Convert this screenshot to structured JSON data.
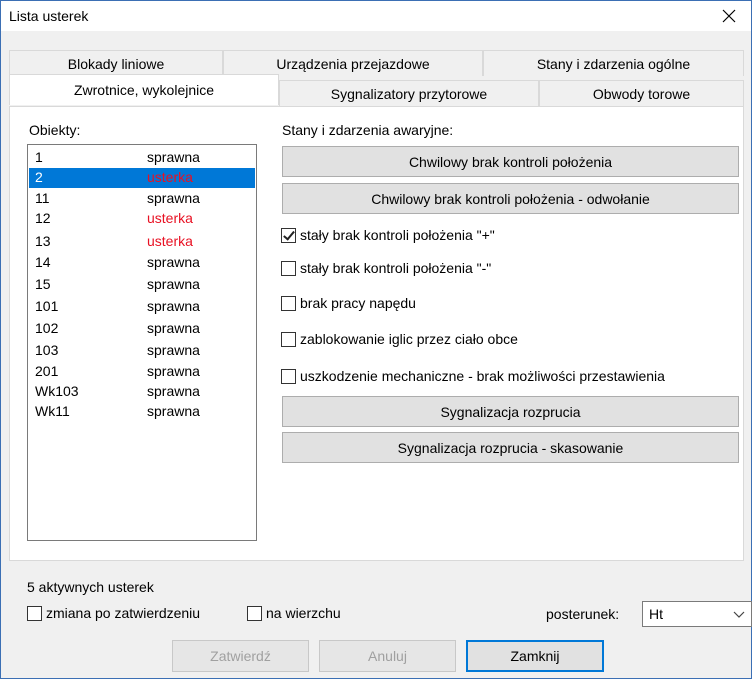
{
  "window": {
    "title": "Lista usterek"
  },
  "tabs": {
    "top": [
      {
        "label": "Blokady liniowe"
      },
      {
        "label": "Urządzenia przejazdowe"
      },
      {
        "label": "Stany i zdarzenia ogólne"
      }
    ],
    "bottom": [
      {
        "label": "Zwrotnice, wykolejnice",
        "active": true
      },
      {
        "label": "Sygnalizatory przytorowe"
      },
      {
        "label": "Obwody torowe"
      }
    ]
  },
  "objects": {
    "label": "Obiekty:",
    "items": [
      {
        "name": "1",
        "state": "sprawna"
      },
      {
        "name": "2",
        "state": "usterka",
        "selected": true
      },
      {
        "name": "11",
        "state": "sprawna"
      },
      {
        "name": "12",
        "state": "usterka"
      },
      {
        "name": "13",
        "state": "usterka"
      },
      {
        "name": "14",
        "state": "sprawna"
      },
      {
        "name": "15",
        "state": "sprawna"
      },
      {
        "name": "101",
        "state": "sprawna"
      },
      {
        "name": "102",
        "state": "sprawna"
      },
      {
        "name": "103",
        "state": "sprawna"
      },
      {
        "name": "201",
        "state": "sprawna"
      },
      {
        "name": "Wk103",
        "state": "sprawna"
      },
      {
        "name": "Wk11",
        "state": "sprawna"
      }
    ]
  },
  "states": {
    "label": "Stany i zdarzenia awaryjne:",
    "buttons": {
      "b1": "Chwilowy brak kontroli położenia",
      "b2": "Chwilowy brak kontroli położenia - odwołanie",
      "b3": "Sygnalizacja rozprucia",
      "b4": "Sygnalizacja rozprucia - skasowanie"
    },
    "checks": [
      {
        "label": "stały brak kontroli położenia \"+\"",
        "checked": true
      },
      {
        "label": "stały brak kontroli położenia \"-\"",
        "checked": false
      },
      {
        "label": "brak pracy napędu",
        "checked": false
      },
      {
        "label": "zablokowanie iglic przez ciało obce",
        "checked": false
      },
      {
        "label": "uszkodzenie mechaniczne - brak możliwości przestawienia",
        "checked": false
      }
    ]
  },
  "footer": {
    "active_count": "5 aktywnych usterek",
    "change_after_confirm": "zmiana po zatwierdzeniu",
    "on_top": "na wierzchu",
    "posterunek_label": "posterunek:",
    "posterunek_value": "Ht",
    "confirm": "Zatwierdź",
    "cancel": "Anuluj",
    "close": "Zamknij"
  },
  "colors": {
    "selection": "#0078d7",
    "error": "#e81123"
  }
}
